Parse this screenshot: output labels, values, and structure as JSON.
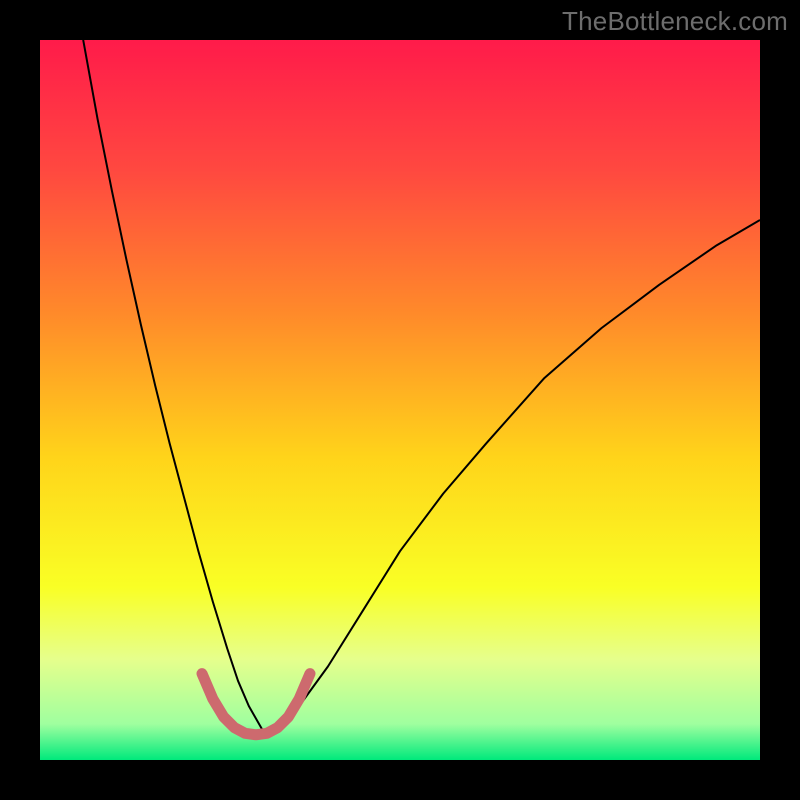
{
  "watermark": "TheBottleneck.com",
  "chart_data": {
    "type": "line",
    "title": "",
    "xlabel": "",
    "ylabel": "",
    "xlim": [
      0,
      100
    ],
    "ylim": [
      0,
      100
    ],
    "grid": false,
    "legend": false,
    "background": {
      "type": "vertical-gradient",
      "stops": [
        {
          "pos": 0.0,
          "color": "#ff1b4a"
        },
        {
          "pos": 0.18,
          "color": "#ff4840"
        },
        {
          "pos": 0.38,
          "color": "#ff8a2a"
        },
        {
          "pos": 0.58,
          "color": "#ffd41a"
        },
        {
          "pos": 0.76,
          "color": "#f9ff25"
        },
        {
          "pos": 0.86,
          "color": "#e6ff8c"
        },
        {
          "pos": 0.95,
          "color": "#9fff9f"
        },
        {
          "pos": 1.0,
          "color": "#00e97c"
        }
      ]
    },
    "series": [
      {
        "name": "bottleneck-curve",
        "stroke": "#000000",
        "stroke_width": 2,
        "x": [
          6,
          8,
          10,
          12,
          14,
          16,
          18,
          20,
          22,
          24,
          26,
          27.5,
          29,
          31,
          33,
          36,
          40,
          45,
          50,
          56,
          62,
          70,
          78,
          86,
          94,
          100
        ],
        "values": [
          100,
          89,
          79,
          69.5,
          60.5,
          52,
          44,
          36.5,
          29,
          22,
          15.5,
          11,
          7.5,
          4,
          4,
          7.5,
          13,
          21,
          29,
          37,
          44,
          53,
          60,
          66,
          71.5,
          75
        ]
      },
      {
        "name": "sweet-spot-highlight",
        "stroke": "#cd6a6e",
        "stroke_width": 11,
        "linecap": "round",
        "x": [
          22.5,
          24,
          25.5,
          27,
          28.5,
          30,
          31.5,
          33,
          34.5,
          36,
          37.5
        ],
        "values": [
          12,
          8.5,
          6,
          4.5,
          3.7,
          3.5,
          3.7,
          4.5,
          6,
          8.5,
          12
        ]
      }
    ]
  }
}
